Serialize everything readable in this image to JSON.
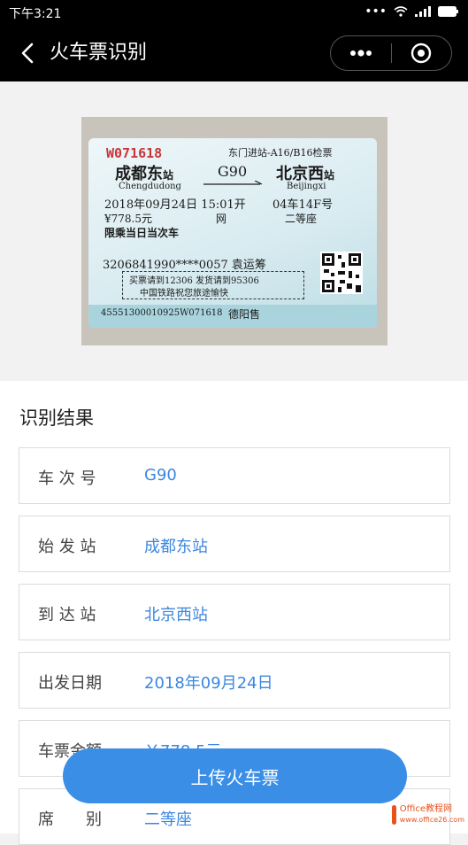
{
  "status_bar": {
    "time": "下午3:21",
    "battery": "100"
  },
  "nav": {
    "title": "火车票识别"
  },
  "ticket": {
    "serial": "W071618",
    "gate": "东门进站-A16/B16检票",
    "from_station": "成都东",
    "station_suffix": "站",
    "train_no": "G90",
    "to_station": "北京西",
    "from_pinyin": "Chengdudong",
    "to_pinyin": "Beijingxi",
    "date_time": "2018年09月24日 15:01开",
    "seat": "04车14F号",
    "price": "¥778.5元",
    "channel": "网",
    "seat_class": "二等座",
    "limit": "限乘当日当次车",
    "id_name": "3206841990****0057 袁运筹",
    "notice1": "买票请到12306 发货请到95306",
    "notice2": "中国铁路祝您旅途愉快",
    "bottom_code": "45551300010925W071618",
    "sold_at": "德阳售"
  },
  "result": {
    "title": "识别结果",
    "rows": [
      {
        "label": "车 次 号",
        "value": "G90"
      },
      {
        "label": "始 发 站",
        "value": "成都东站"
      },
      {
        "label": "到 达 站",
        "value": "北京西站"
      },
      {
        "label": "出发日期",
        "value": "2018年09月24日"
      },
      {
        "label": "车票金额",
        "value": "￥778.5元"
      },
      {
        "label": "席　　别",
        "value": "二等座"
      }
    ]
  },
  "upload_button": {
    "label": "上传火车票"
  },
  "watermark": {
    "line1": "Office教程网",
    "line2": "www.office26.com"
  }
}
